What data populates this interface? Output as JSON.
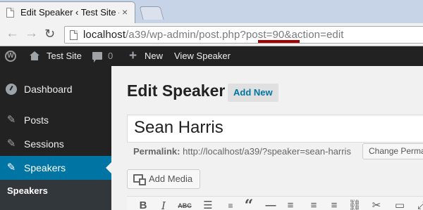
{
  "browser": {
    "tab_title": "Edit Speaker ‹ Test Site —",
    "tab_close": "×",
    "url_host": "localhost",
    "url_rest": "/a39/wp-admin/post.php?post=90&action=edit"
  },
  "adminbar": {
    "site_name": "Test Site",
    "comments_count": "0",
    "new_label": "New",
    "view_label": "View Speaker"
  },
  "sidebar": {
    "items": [
      {
        "label": "Dashboard",
        "icon": "dashboard-icon"
      },
      {
        "label": "Posts",
        "icon": "pin-icon"
      },
      {
        "label": "Sessions",
        "icon": "pin-icon"
      },
      {
        "label": "Speakers",
        "icon": "pin-icon",
        "active": true
      }
    ],
    "submenu_current": "Speakers",
    "active_color": "#0074a2"
  },
  "main": {
    "page_title": "Edit Speaker",
    "add_new_label": "Add New",
    "post_title_value": "Sean Harris",
    "permalink_label": "Permalink:",
    "permalink_url": "http://localhost/a39/?speaker=sean-harris",
    "change_permalink_label": "Change Permalinks",
    "add_media_label": "Add Media"
  },
  "editor_toolbar": {
    "buttons": [
      "bold",
      "italic",
      "strikethrough",
      "bulleted-list",
      "numbered-list",
      "blockquote",
      "horizontal-rule",
      "align-left",
      "align-center",
      "align-right",
      "insert-link",
      "remove-link",
      "read-more",
      "toolbar-toggle"
    ],
    "bold_glyph": "B",
    "italic_glyph": "I",
    "strike_glyph": "ABC",
    "quote_glyph": "“"
  },
  "colors": {
    "admin_bar": "#222222",
    "sidebar": "#222222",
    "link_blue": "#0074a2",
    "url_highlight": "#a40000"
  }
}
